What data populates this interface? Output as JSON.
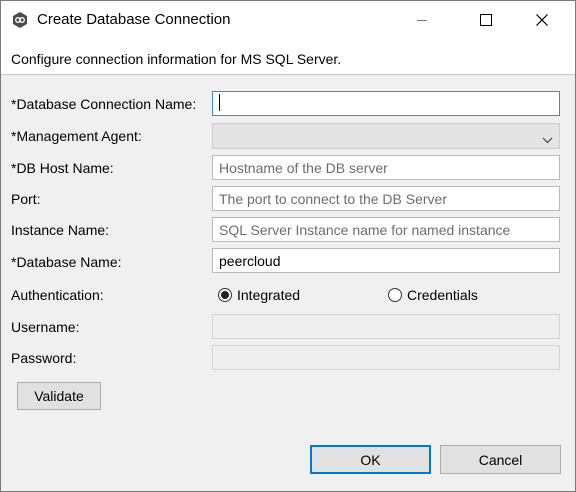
{
  "window": {
    "title": "Create Database Connection",
    "app_icon": "database-connection-icon",
    "controls": [
      "minimize-icon",
      "maximize-icon",
      "close-icon"
    ]
  },
  "header": {
    "description": "Configure connection information for MS SQL Server."
  },
  "form": {
    "connection_name": {
      "label": "*Database Connection Name:",
      "value": "",
      "placeholder": ""
    },
    "management_agent": {
      "label": "*Management Agent:",
      "value": ""
    },
    "db_host": {
      "label": "*DB Host Name:",
      "value": "",
      "placeholder": "Hostname of the DB server"
    },
    "port": {
      "label": "Port:",
      "value": "",
      "placeholder": "The port to connect to the DB Server"
    },
    "instance": {
      "label": "Instance Name:",
      "value": "",
      "placeholder": "SQL Server Instance name for named instance"
    },
    "database_name": {
      "label": "*Database Name:",
      "value": "peercloud"
    },
    "authentication": {
      "label": "Authentication:",
      "options": [
        {
          "label": "Integrated",
          "selected": true
        },
        {
          "label": "Credentials",
          "selected": false
        }
      ]
    },
    "username": {
      "label": "Username:",
      "value": "",
      "enabled": false
    },
    "password": {
      "label": "Password:",
      "value": "",
      "enabled": false
    }
  },
  "buttons": {
    "validate": "Validate",
    "ok": "OK",
    "cancel": "Cancel"
  },
  "colors": {
    "focus_border": "#3a8ad6",
    "default_button_border": "#0078d7",
    "dialog_background": "#f0f0f0"
  }
}
